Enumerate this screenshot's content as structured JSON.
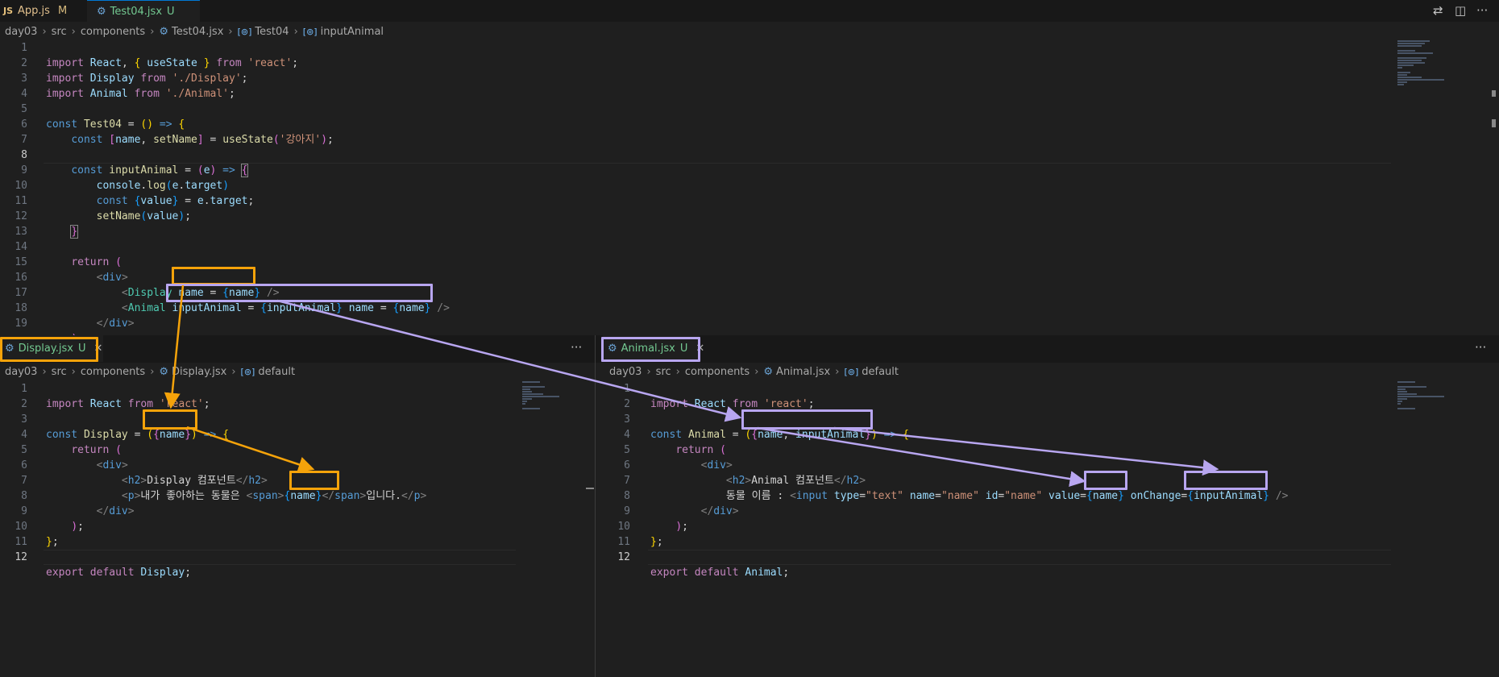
{
  "top_tabs": [
    {
      "icon": "JS",
      "label": "App.js",
      "status": "M"
    },
    {
      "icon": "gear-icon",
      "label": "Test04.jsx",
      "status": "U"
    }
  ],
  "top_breadcrumb": [
    "day03",
    "src",
    "components",
    "Test04.jsx",
    "Test04",
    "inputAnimal"
  ],
  "display_tab": {
    "label": "Display.jsx",
    "status": "U"
  },
  "animal_tab": {
    "label": "Animal.jsx",
    "status": "U"
  },
  "display_breadcrumb": [
    "day03",
    "src",
    "components",
    "Display.jsx",
    "default"
  ],
  "animal_breadcrumb": [
    "day03",
    "src",
    "components",
    "Animal.jsx",
    "default"
  ],
  "more_actions": "···",
  "colors": {
    "orange_highlight": "#f5a30a",
    "lavender_highlight": "#b8a6f0"
  },
  "test04_code": [
    "import React, { useState } from 'react';",
    "import Display from './Display';",
    "import Animal from './Animal';",
    "",
    "const Test04 = () => {",
    "    const [name, setName] = useState('강아지');",
    "",
    "    const inputAnimal = (e) => {",
    "        console.log(e.target)",
    "        const {value} = e.target;",
    "        setName(value);",
    "    }",
    "",
    "    return (",
    "        <div>",
    "            <Display name = {name} />",
    "            <Animal inputAnimal = {inputAnimal} name = {name} />",
    "        </div>",
    "    );"
  ],
  "display_code": [
    "import React from 'react';",
    "",
    "const Display = ({name}) => {",
    "    return (",
    "        <div>",
    "            <h2>Display 컴포넌트</h2>",
    "            <p>내가 좋아하는 동물은 <span>{name}</span>입니다.</p>",
    "        </div>",
    "    );",
    "};",
    "",
    "export default Display;"
  ],
  "animal_code": [
    "import React from 'react';",
    "",
    "const Animal = ({name, inputAnimal}) => {",
    "    return (",
    "        <div>",
    "            <h2>Animal 컴포넌트</h2>",
    "            동물 이름 : <input type=\"text\" name=\"name\" id=\"name\" value={name} onChange={inputAnimal} />",
    "        </div>",
    "    );",
    "};",
    "",
    "export default Animal;"
  ]
}
